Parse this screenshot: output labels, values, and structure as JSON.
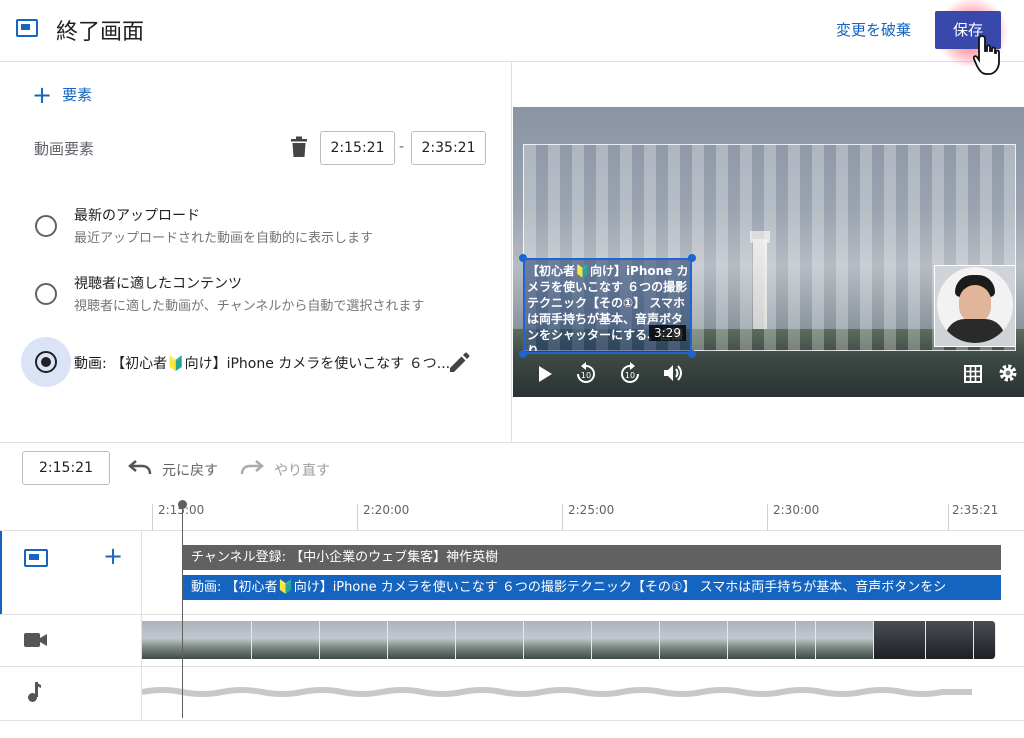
{
  "header": {
    "title": "終了画面",
    "discard_label": "変更を破棄",
    "save_label": "保存"
  },
  "editor": {
    "add_element_label": "要素",
    "video_element_label": "動画要素",
    "start_time": "2:15:21",
    "range_dash": "-",
    "end_time": "2:35:21",
    "options": [
      {
        "title": "最新のアップロード",
        "description": "最近アップロードされた動画を自動的に表示します",
        "selected": false
      },
      {
        "title": "視聴者に適したコンテンツ",
        "description": "視聴者に適した動画が、チャンネルから自動で選択されます",
        "selected": false
      },
      {
        "title": "動画: 【初心者🔰向け】iPhone カメラを使いこなす ６つ...",
        "selected": true
      }
    ]
  },
  "preview": {
    "card_text": "【初心者🔰向け】iPhone カメラを使いこなす ６つの撮影テクニック【その①】 スマホは両手持ちが基本、音声ボタンをシャッターにする、自撮り",
    "card_duration": "3:29",
    "icons": [
      "play-icon",
      "rewind-10-icon",
      "forward-10-icon",
      "volume-icon",
      "grid-icon",
      "settings-icon"
    ]
  },
  "timeline": {
    "current_time": "2:15:21",
    "undo_label": "元に戻す",
    "redo_label": "やり直す",
    "ticks": [
      "2:15:00",
      "2:20:00",
      "2:25:00",
      "2:30:00",
      "2:35:21"
    ],
    "channel_element_label": "チャンネル登録: 【中小企業のウェブ集客】神作英樹",
    "video_element_label": "動画: 【初心者🔰向け】iPhone カメラを使いこなす ６つの撮影テクニック【その①】 スマホは両手持ちが基本、音声ボタンをシ"
  },
  "colors": {
    "accent": "#1565c0",
    "save_button": "#3949ab",
    "channel_bar": "#616161"
  }
}
